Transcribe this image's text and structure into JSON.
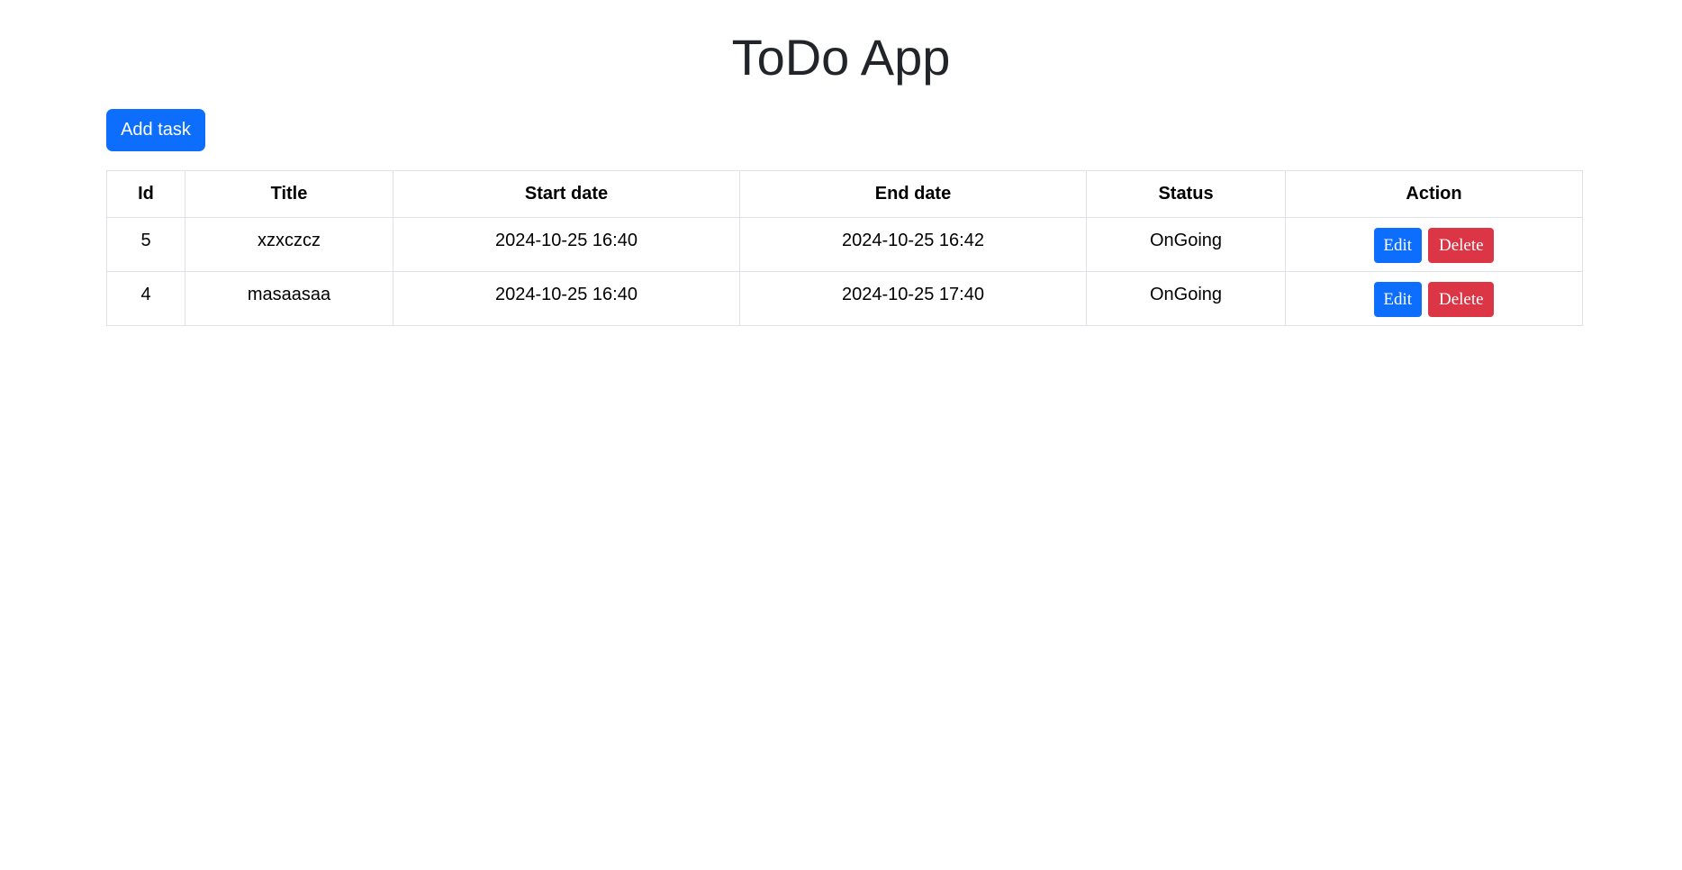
{
  "app": {
    "title": "ToDo App",
    "add_task_label": "Add task"
  },
  "table": {
    "headers": [
      "Id",
      "Title",
      "Start date",
      "End date",
      "Status",
      "Action"
    ],
    "rows": [
      {
        "id": "5",
        "title": "xzxczcz",
        "start_date": "2024-10-25 16:40",
        "end_date": "2024-10-25 16:42",
        "status": "OnGoing",
        "edit_label": "Edit",
        "delete_label": "Delete"
      },
      {
        "id": "4",
        "title": "masaasaa",
        "start_date": "2024-10-25 16:40",
        "end_date": "2024-10-25 17:40",
        "status": "OnGoing",
        "edit_label": "Edit",
        "delete_label": "Delete"
      }
    ]
  },
  "colors": {
    "primary": "#0d6efd",
    "danger": "#dc3545",
    "border": "#dee2e6",
    "heading": "#212529"
  }
}
